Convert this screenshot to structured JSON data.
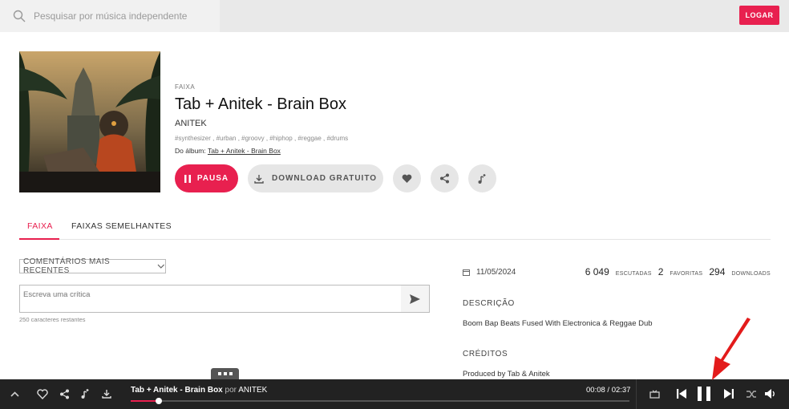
{
  "search": {
    "placeholder": "Pesquisar por música independente"
  },
  "header": {
    "login_label": "LOGAR"
  },
  "track": {
    "kind": "FAIXA",
    "title": "Tab + Anitek - Brain Box",
    "artist": "ANITEK",
    "tags": "#synthesizer , #urban , #groovy , #hiphop , #reggae , #drums",
    "album_prefix": "Do álbum:",
    "album_name": "Tab + Anitek - Brain Box"
  },
  "actions": {
    "pause_label": "PAUSA",
    "download_label": "DOWNLOAD GRATUITO"
  },
  "tabs": [
    {
      "label": "FAIXA"
    },
    {
      "label": "FAIXAS SEMELHANTES"
    }
  ],
  "comments": {
    "sort_label": "COMENTÁRIOS MAIS RECENTES",
    "review_placeholder": "Escreva uma crítica",
    "remaining": "250 caracteres restantes"
  },
  "info": {
    "date": "11/05/2024",
    "plays_num": "6 049",
    "plays_label": "ESCUTADAS",
    "favs_num": "2",
    "favs_label": "FAVORITAS",
    "downloads_num": "294",
    "downloads_label": "DOWNLOADS",
    "description_heading": "DESCRIÇÃO",
    "description": "Boom Bap Beats Fused With Electronica & Reggae Dub",
    "credits_heading": "CRÉDITOS",
    "credits": "Produced by Tab & Anitek"
  },
  "player": {
    "title": "Tab + Anitek - Brain Box",
    "by": "por",
    "artist": "ANITEK",
    "time": "00:08 / 02:37",
    "progress": 0.056
  },
  "colors": {
    "accent": "#e8204f",
    "player_bg": "#222222",
    "annotation_arrow": "#e31b1b"
  }
}
